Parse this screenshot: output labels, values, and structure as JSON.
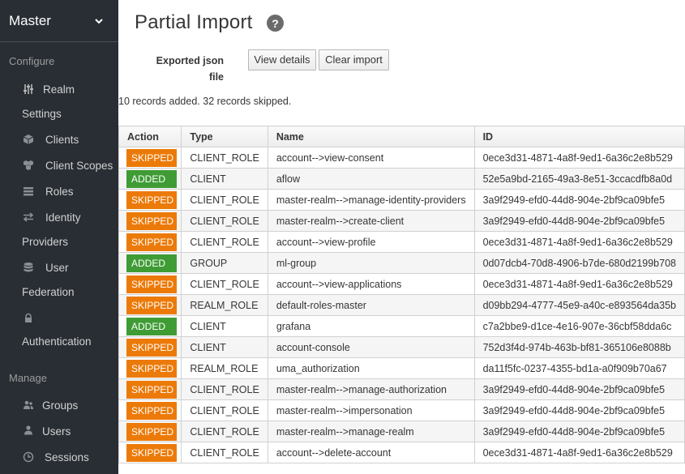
{
  "sidebar": {
    "realm": "Master",
    "configure_title": "Configure",
    "manage_title": "Manage",
    "configure_items": [
      {
        "label": "Realm",
        "label2": "Settings",
        "icon": "sliders-icon"
      },
      {
        "label": "Clients",
        "icon": "cube-icon"
      },
      {
        "label": "Client Scopes",
        "icon": "cubes-icon"
      },
      {
        "label": "Roles",
        "icon": "list-icon"
      },
      {
        "label": "Identity",
        "label2": "Providers",
        "icon": "exchange-icon"
      },
      {
        "label": "User",
        "label2": "Federation",
        "icon": "database-icon"
      },
      {
        "label": "",
        "label2": "Authentication",
        "icon": "lock-icon"
      }
    ],
    "manage_items": [
      {
        "label": "Groups",
        "icon": "users-icon"
      },
      {
        "label": "Users",
        "icon": "user-icon"
      },
      {
        "label": "Sessions",
        "icon": "clock-icon"
      }
    ]
  },
  "page": {
    "title": "Partial Import",
    "help_glyph": "?",
    "file_label": "Exported json file",
    "view_details": "View details",
    "clear_import": "Clear import",
    "summary": "10 records added. 32 records skipped."
  },
  "colors": {
    "skipped": "#ec7a08",
    "added": "#3f9c35",
    "sidebar_bg": "#292e34"
  },
  "table": {
    "headers": {
      "action": "Action",
      "type": "Type",
      "name": "Name",
      "id": "ID"
    },
    "rows": [
      {
        "action": "SKIPPED",
        "type": "CLIENT_ROLE",
        "name": "account-->view-consent",
        "id": "0ece3d31-4871-4a8f-9ed1-6a36c2e8b529"
      },
      {
        "action": "ADDED",
        "type": "CLIENT",
        "name": "aflow",
        "id": "52e5a9bd-2165-49a3-8e51-3ccacdfb8a0d"
      },
      {
        "action": "SKIPPED",
        "type": "CLIENT_ROLE",
        "name": "master-realm-->manage-identity-providers",
        "id": "3a9f2949-efd0-44d8-904e-2bf9ca09bfe5"
      },
      {
        "action": "SKIPPED",
        "type": "CLIENT_ROLE",
        "name": "master-realm-->create-client",
        "id": "3a9f2949-efd0-44d8-904e-2bf9ca09bfe5"
      },
      {
        "action": "SKIPPED",
        "type": "CLIENT_ROLE",
        "name": "account-->view-profile",
        "id": "0ece3d31-4871-4a8f-9ed1-6a36c2e8b529"
      },
      {
        "action": "ADDED",
        "type": "GROUP",
        "name": "ml-group",
        "id": "0d07dcb4-70d8-4906-b7de-680d2199b708"
      },
      {
        "action": "SKIPPED",
        "type": "CLIENT_ROLE",
        "name": "account-->view-applications",
        "id": "0ece3d31-4871-4a8f-9ed1-6a36c2e8b529"
      },
      {
        "action": "SKIPPED",
        "type": "REALM_ROLE",
        "name": "default-roles-master",
        "id": "d09bb294-4777-45e9-a40c-e893564da35b"
      },
      {
        "action": "ADDED",
        "type": "CLIENT",
        "name": "grafana",
        "id": "c7a2bbe9-d1ce-4e16-907e-36cbf58dda6c"
      },
      {
        "action": "SKIPPED",
        "type": "CLIENT",
        "name": "account-console",
        "id": "752d3f4d-974b-463b-bf81-365106e8088b"
      },
      {
        "action": "SKIPPED",
        "type": "REALM_ROLE",
        "name": "uma_authorization",
        "id": "da11f5fc-0237-4355-bd1a-a0f909b70a67"
      },
      {
        "action": "SKIPPED",
        "type": "CLIENT_ROLE",
        "name": "master-realm-->manage-authorization",
        "id": "3a9f2949-efd0-44d8-904e-2bf9ca09bfe5"
      },
      {
        "action": "SKIPPED",
        "type": "CLIENT_ROLE",
        "name": "master-realm-->impersonation",
        "id": "3a9f2949-efd0-44d8-904e-2bf9ca09bfe5"
      },
      {
        "action": "SKIPPED",
        "type": "CLIENT_ROLE",
        "name": "master-realm-->manage-realm",
        "id": "3a9f2949-efd0-44d8-904e-2bf9ca09bfe5"
      },
      {
        "action": "SKIPPED",
        "type": "CLIENT_ROLE",
        "name": "account-->delete-account",
        "id": "0ece3d31-4871-4a8f-9ed1-6a36c2e8b529"
      }
    ]
  }
}
